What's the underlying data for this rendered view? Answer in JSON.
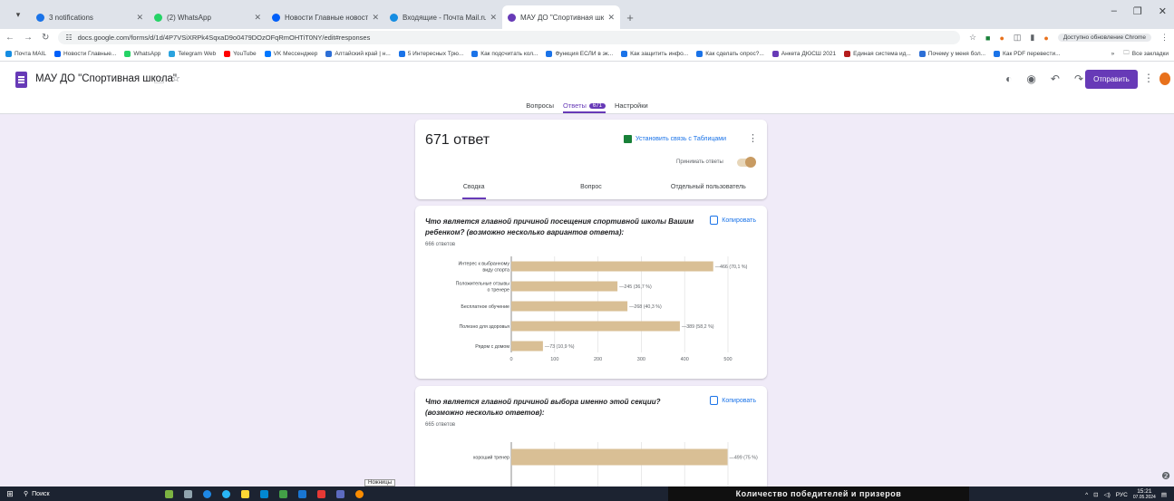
{
  "browser": {
    "tabs": [
      {
        "title": "3 notifications",
        "color": "#1a73e8",
        "active": false
      },
      {
        "title": "(2) WhatsApp",
        "color": "#25d366",
        "active": false
      },
      {
        "title": "Новости Главные новости се",
        "color": "#005ff9",
        "active": false
      },
      {
        "title": "Входящие - Почта Mail.ru",
        "color": "#168de2",
        "active": false
      },
      {
        "title": "МАУ ДО \"Спортивная школа\"",
        "color": "#673ab7",
        "active": true
      }
    ],
    "url": "docs.google.com/forms/d/1d/4P7VSiXRPk4SqxaD9o0479DOzOFqRmOHTiT0NY/edit#responses",
    "profile": "Доступно обновление Chrome",
    "bookmarks": [
      {
        "label": "Почта MAIL",
        "color": "#168de2"
      },
      {
        "label": "Новости Главные...",
        "color": "#005ff9"
      },
      {
        "label": "WhatsApp",
        "color": "#25d366"
      },
      {
        "label": "Telegram Web",
        "color": "#2aa3df"
      },
      {
        "label": "YouTube",
        "color": "#ff0000"
      },
      {
        "label": "VK Мессенджер",
        "color": "#0077ff"
      },
      {
        "label": "Алтайский край | н...",
        "color": "#2d6fd6"
      },
      {
        "label": "5 Интересных Трю...",
        "color": "#1a73e8"
      },
      {
        "label": "Как подсчитать кол...",
        "color": "#1a73e8"
      },
      {
        "label": "Функция ЕСЛИ в эк...",
        "color": "#1a73e8"
      },
      {
        "label": "Как защитить инфо...",
        "color": "#1a73e8"
      },
      {
        "label": "Как сделать опрос?...",
        "color": "#1a73e8"
      },
      {
        "label": "Анкета ДЮСШ 2021",
        "color": "#673ab7"
      },
      {
        "label": "Единая система ид...",
        "color": "#b51c1c"
      },
      {
        "label": "Почему у меня бол...",
        "color": "#2d6fd6"
      },
      {
        "label": "Как PDF перевести...",
        "color": "#1a73e8"
      }
    ],
    "all_bookmarks": "Все закладки"
  },
  "forms": {
    "doc_title": "МАУ ДО \"Спортивная школа\"",
    "send_label": "Отправить",
    "tabs": [
      {
        "label": "Вопросы",
        "active": false
      },
      {
        "label": "Ответы",
        "badge": "671",
        "active": true
      },
      {
        "label": "Настройки",
        "active": false
      }
    ]
  },
  "summary": {
    "count_label": "671 ответ",
    "link_sheets": "Установить связь с Таблицами",
    "accept_label": "Принимать ответы",
    "subtabs": [
      "Сводка",
      "Вопрос",
      "Отдельный пользователь"
    ]
  },
  "q1": {
    "title": "Что является главной причиной посещения спортивной школы  Вашим ребенком?  (возможно несколько вариантов ответа):",
    "count": "666 ответов",
    "copy": "Копировать"
  },
  "q2": {
    "title": "Что является главной причиной выбора именно этой секции?  (возможно несколько ответов):",
    "count": "665 ответов",
    "copy": "Копировать"
  },
  "chart_data": [
    {
      "type": "bar",
      "orientation": "horizontal",
      "categories": [
        "Интерес к выбранному виду спорта",
        "Положительные отзывы о тренере",
        "Бесплатное обучение",
        "Полезно для здоровья",
        "Рядом с домом"
      ],
      "values": [
        466,
        245,
        268,
        389,
        73
      ],
      "value_labels": [
        "466 (70,1 %)",
        "245 (36,7 %)",
        "268 (40,3 %)",
        "389 (58,2 %)",
        "73 (10,9 %)"
      ],
      "xlim": [
        0,
        500
      ],
      "xticks": [
        "0",
        "100",
        "200",
        "300",
        "400",
        "500"
      ],
      "bar_color": "#d9bf95",
      "grid": true
    },
    {
      "type": "bar",
      "orientation": "horizontal",
      "categories": [
        "хороший тренер"
      ],
      "values": [
        499
      ],
      "value_labels": [
        "499 (75 %)"
      ],
      "xlim": [
        0,
        500
      ],
      "bar_color": "#d9bf95",
      "grid": true
    }
  ],
  "taskbar": {
    "search": "Поиск",
    "banner": "Количество победителей и призеров",
    "tooltip": "Ножницы",
    "lang": "РУС",
    "time": "15:21",
    "date": "07.05.2024"
  }
}
